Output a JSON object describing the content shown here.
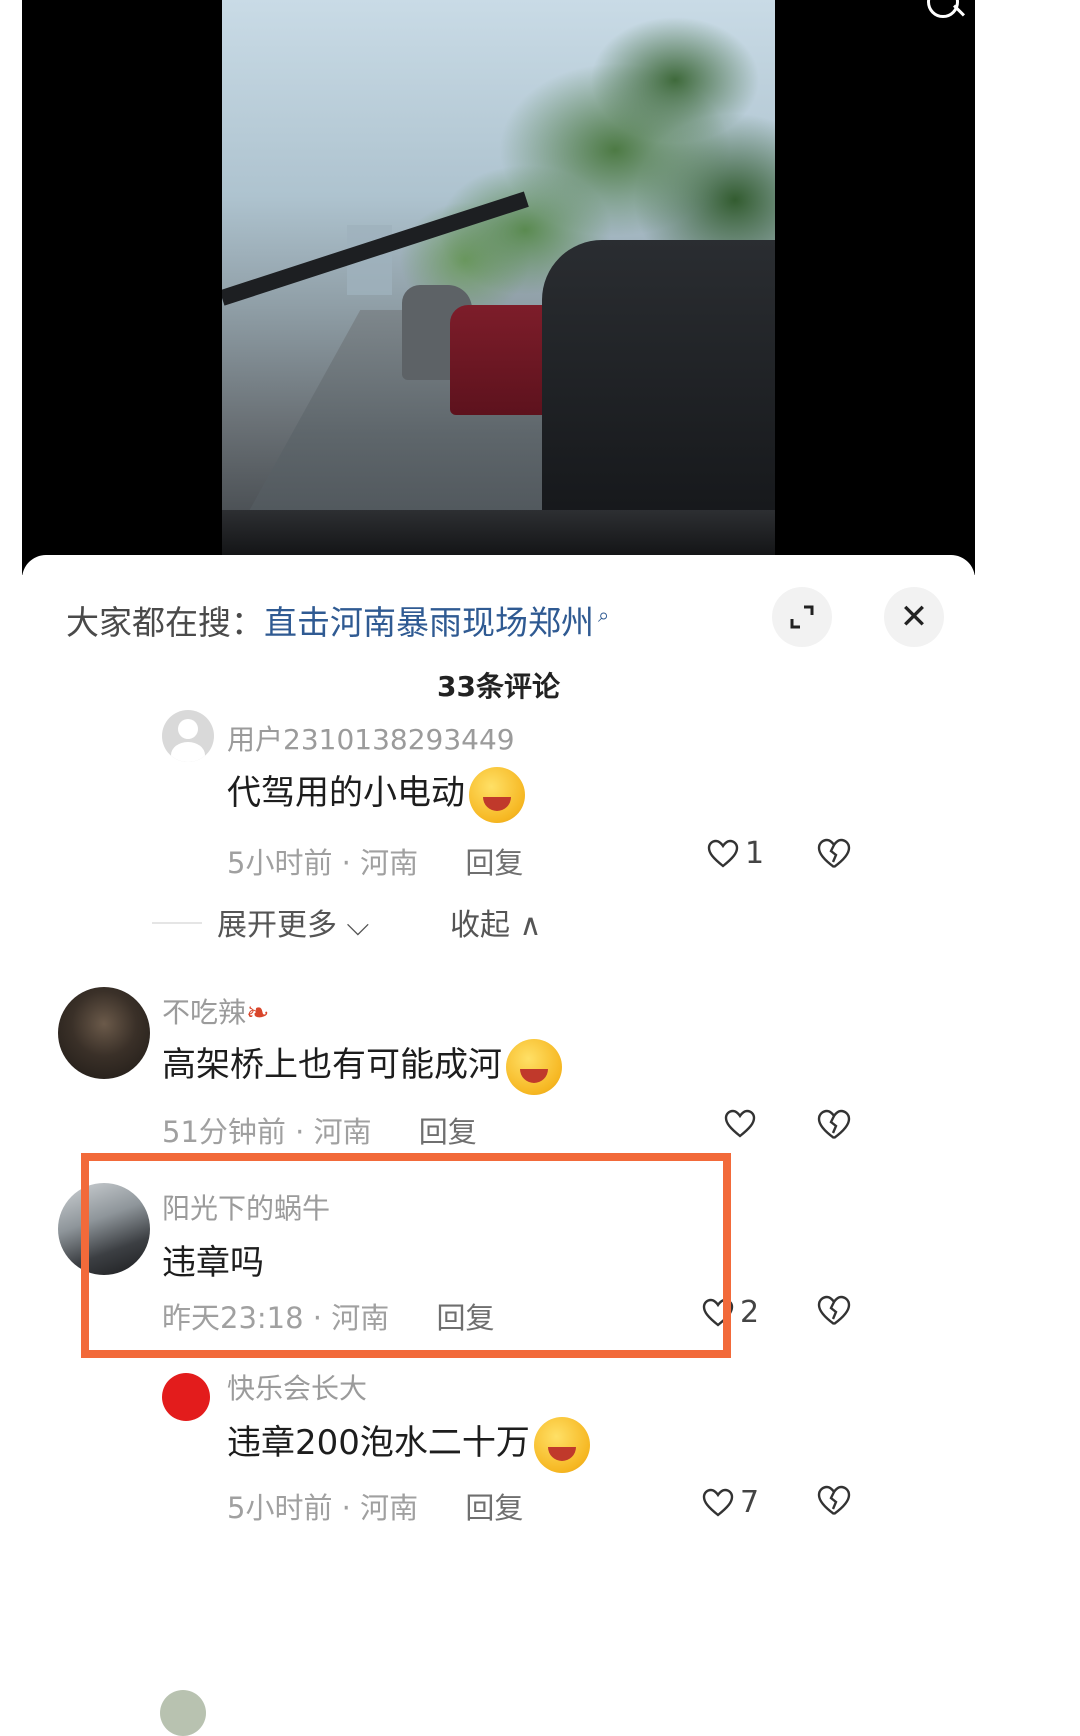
{
  "video": {
    "description_icon": "search-icon"
  },
  "panel": {
    "search_prefix": "大家都在搜：",
    "search_term": "直击河南暴雨现场郑州",
    "search_term_icon": "magnifier-icon",
    "expand_icon": "expand-icon",
    "close_symbol": "✕",
    "comment_count": "33条评论"
  },
  "comments": [
    {
      "username": "用户2310138293449",
      "text": "代驾用的小电动",
      "emoji": "cry-laugh-emoji",
      "time": "5小时前",
      "location": "河南",
      "reply": "回复",
      "likes": "1"
    },
    {
      "username": "不吃辣",
      "text": "高架桥上也有可能成河",
      "emoji": "cry-emoji",
      "time": "51分钟前",
      "location": "河南",
      "reply": "回复",
      "likes": ""
    },
    {
      "username": "阳光下的蜗牛",
      "text": "违章吗",
      "time": "昨天23:18",
      "location": "河南",
      "reply": "回复",
      "likes": "2"
    },
    {
      "username": "快乐会长大",
      "text": "违章200泡水二十万",
      "emoji": "worried-emoji",
      "time": "5小时前",
      "location": "河南",
      "reply": "回复",
      "likes": "7"
    }
  ],
  "expand_more": "展开更多",
  "collapse": "收起",
  "sep": "·",
  "colors": {
    "highlight": "#f26a3a",
    "search_term": "#2f5a92",
    "name": "#9b9b9b"
  }
}
